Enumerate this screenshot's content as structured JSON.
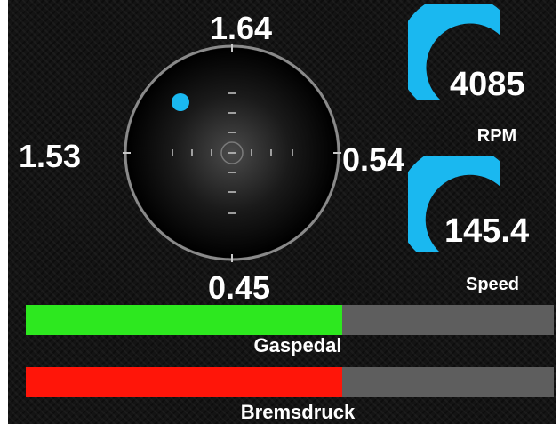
{
  "gforce": {
    "top": "1.64",
    "left": "1.53",
    "right": "0.54",
    "bottom": "0.45",
    "dot_color": "#1ab8f0",
    "ring_color": "#8a8a8a"
  },
  "rpm": {
    "value": "4085",
    "label": "RPM",
    "arc_color": "#1ab8f0"
  },
  "speed": {
    "value": "145.4",
    "label": "Speed",
    "arc_color": "#1ab8f0"
  },
  "throttle": {
    "label": "Gaspedal",
    "level_fraction": 0.6,
    "color": "#2de81f"
  },
  "brake": {
    "label": "Bremsdruck",
    "level_fraction": 0.6,
    "color": "#ff1509"
  }
}
